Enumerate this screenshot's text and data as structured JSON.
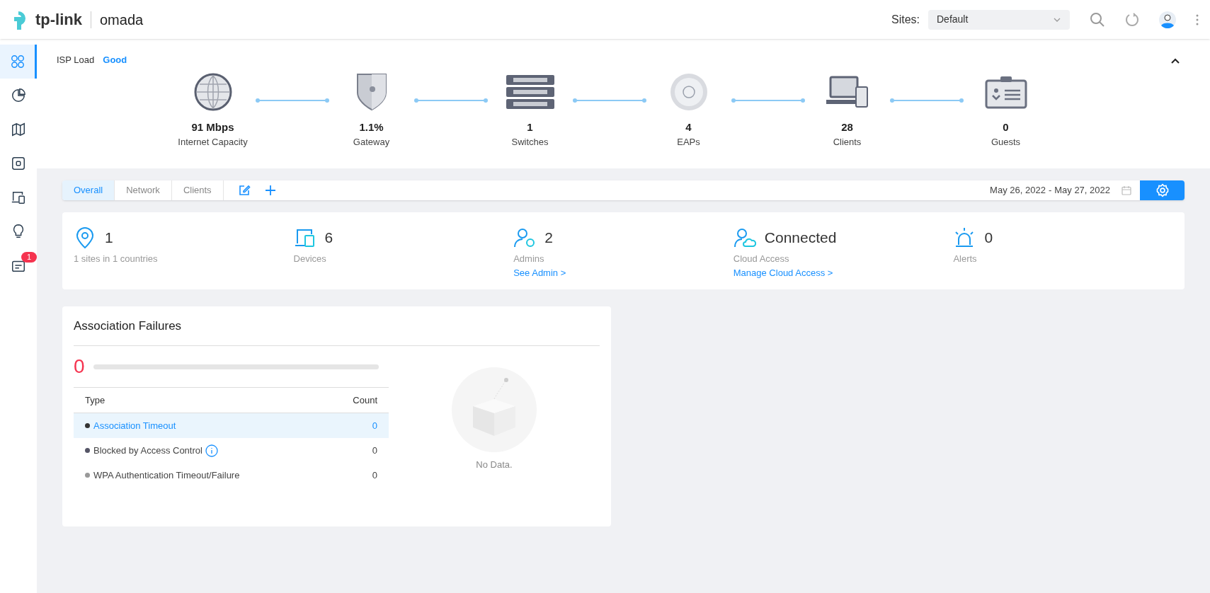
{
  "header": {
    "brand": "tp-link",
    "product": "omada",
    "sites_label": "Sites:",
    "site_select": {
      "value": "Default"
    }
  },
  "sidebar": {
    "items": [
      {
        "kind": "dashboard",
        "selected": true
      },
      {
        "kind": "statistics",
        "selected": false
      },
      {
        "kind": "map",
        "selected": false
      },
      {
        "kind": "devices",
        "selected": false
      },
      {
        "kind": "clients",
        "selected": false
      },
      {
        "kind": "insight",
        "selected": false
      },
      {
        "kind": "log",
        "selected": false,
        "badge": "1"
      }
    ]
  },
  "topology": {
    "isp_load_label": "ISP Load",
    "isp_load_value": "Good",
    "expanded": true,
    "nodes": [
      {
        "kind": "internet",
        "value": "91 Mbps",
        "label": "Internet Capacity"
      },
      {
        "kind": "gateway",
        "value": "1.1%",
        "label": "Gateway"
      },
      {
        "kind": "switch",
        "value": "1",
        "label": "Switches"
      },
      {
        "kind": "eap",
        "value": "4",
        "label": "EAPs"
      },
      {
        "kind": "clients",
        "value": "28",
        "label": "Clients"
      },
      {
        "kind": "guests",
        "value": "0",
        "label": "Guests"
      }
    ]
  },
  "tabs": [
    {
      "label": "Overall",
      "selected": true
    },
    {
      "label": "Network",
      "selected": false
    },
    {
      "label": "Clients",
      "selected": false
    }
  ],
  "date_range": {
    "start": "May 26, 2022",
    "separator": "-",
    "end": "May 27, 2022"
  },
  "stats": [
    {
      "kind": "sites",
      "value": "1",
      "label": "1 sites in 1 countries"
    },
    {
      "kind": "devices",
      "value": "6",
      "label": "Devices"
    },
    {
      "kind": "admins",
      "value": "2",
      "label": "Admins",
      "link": "See Admin >"
    },
    {
      "kind": "cloud",
      "value": "Connected",
      "label": "Cloud Access",
      "link": "Manage Cloud Access >"
    },
    {
      "kind": "alerts",
      "value": "0",
      "label": "Alerts"
    }
  ],
  "association_failures": {
    "title": "Association Failures",
    "total": "0",
    "level": 0,
    "columns": [
      "Type",
      "Count"
    ],
    "rows": [
      {
        "type": "Association Timeout",
        "count": "0",
        "selected": true,
        "color": "#333333",
        "info": false
      },
      {
        "type": "Blocked by Access Control",
        "count": "0",
        "selected": false,
        "color": "#555566",
        "info": true
      },
      {
        "type": "WPA Authentication Timeout/Failure",
        "count": "0",
        "selected": false,
        "color": "#999999",
        "info": false
      }
    ],
    "empty_text": "No Data."
  }
}
